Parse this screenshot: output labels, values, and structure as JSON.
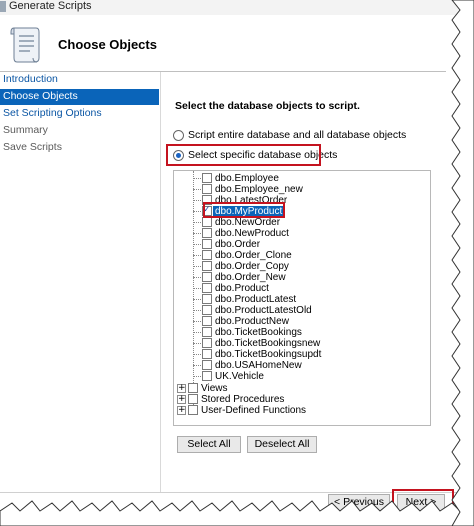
{
  "window": {
    "title": "Generate Scripts"
  },
  "header": {
    "title": "Choose Objects"
  },
  "nav": {
    "items": [
      {
        "label": "Introduction",
        "state": "link"
      },
      {
        "label": "Choose Objects",
        "state": "selected"
      },
      {
        "label": "Set Scripting Options",
        "state": "link"
      },
      {
        "label": "Summary",
        "state": "disabled"
      },
      {
        "label": "Save Scripts",
        "state": "disabled"
      }
    ]
  },
  "main": {
    "heading": "Select the database objects to script.",
    "option_entire": "Script entire database and all database objects",
    "option_specific": "Select specific database objects",
    "selected_option": "specific"
  },
  "tree": {
    "items": [
      {
        "label": "dbo.Employee",
        "checked": false
      },
      {
        "label": "dbo.Employee_new",
        "checked": false
      },
      {
        "label": "dbo.LatestOrder",
        "checked": false
      },
      {
        "label": "dbo.MyProduct",
        "checked": true
      },
      {
        "label": "dbo.NewOrder",
        "checked": false
      },
      {
        "label": "dbo.NewProduct",
        "checked": false
      },
      {
        "label": "dbo.Order",
        "checked": false
      },
      {
        "label": "dbo.Order_Clone",
        "checked": false
      },
      {
        "label": "dbo.Order_Copy",
        "checked": false
      },
      {
        "label": "dbo.Order_New",
        "checked": false
      },
      {
        "label": "dbo.Product",
        "checked": false
      },
      {
        "label": "dbo.ProductLatest",
        "checked": false
      },
      {
        "label": "dbo.ProductLatestOld",
        "checked": false
      },
      {
        "label": "dbo.ProductNew",
        "checked": false
      },
      {
        "label": "dbo.TicketBookings",
        "checked": false
      },
      {
        "label": "dbo.TicketBookingsnew",
        "checked": false
      },
      {
        "label": "dbo.TicketBookingsupdt",
        "checked": false
      },
      {
        "label": "dbo.USAHomeNew",
        "checked": false
      },
      {
        "label": "UK.Vehicle",
        "checked": false
      }
    ],
    "groups": [
      {
        "label": "Views"
      },
      {
        "label": "Stored Procedures"
      },
      {
        "label": "User-Defined Functions"
      }
    ]
  },
  "buttons": {
    "select_all": "Select All",
    "deselect_all": "Deselect All",
    "previous": "< Previous",
    "next": "Next >"
  },
  "colors": {
    "selection": "#0a64b9",
    "highlight_box": "#c4131f",
    "link": "#0b56a4"
  }
}
